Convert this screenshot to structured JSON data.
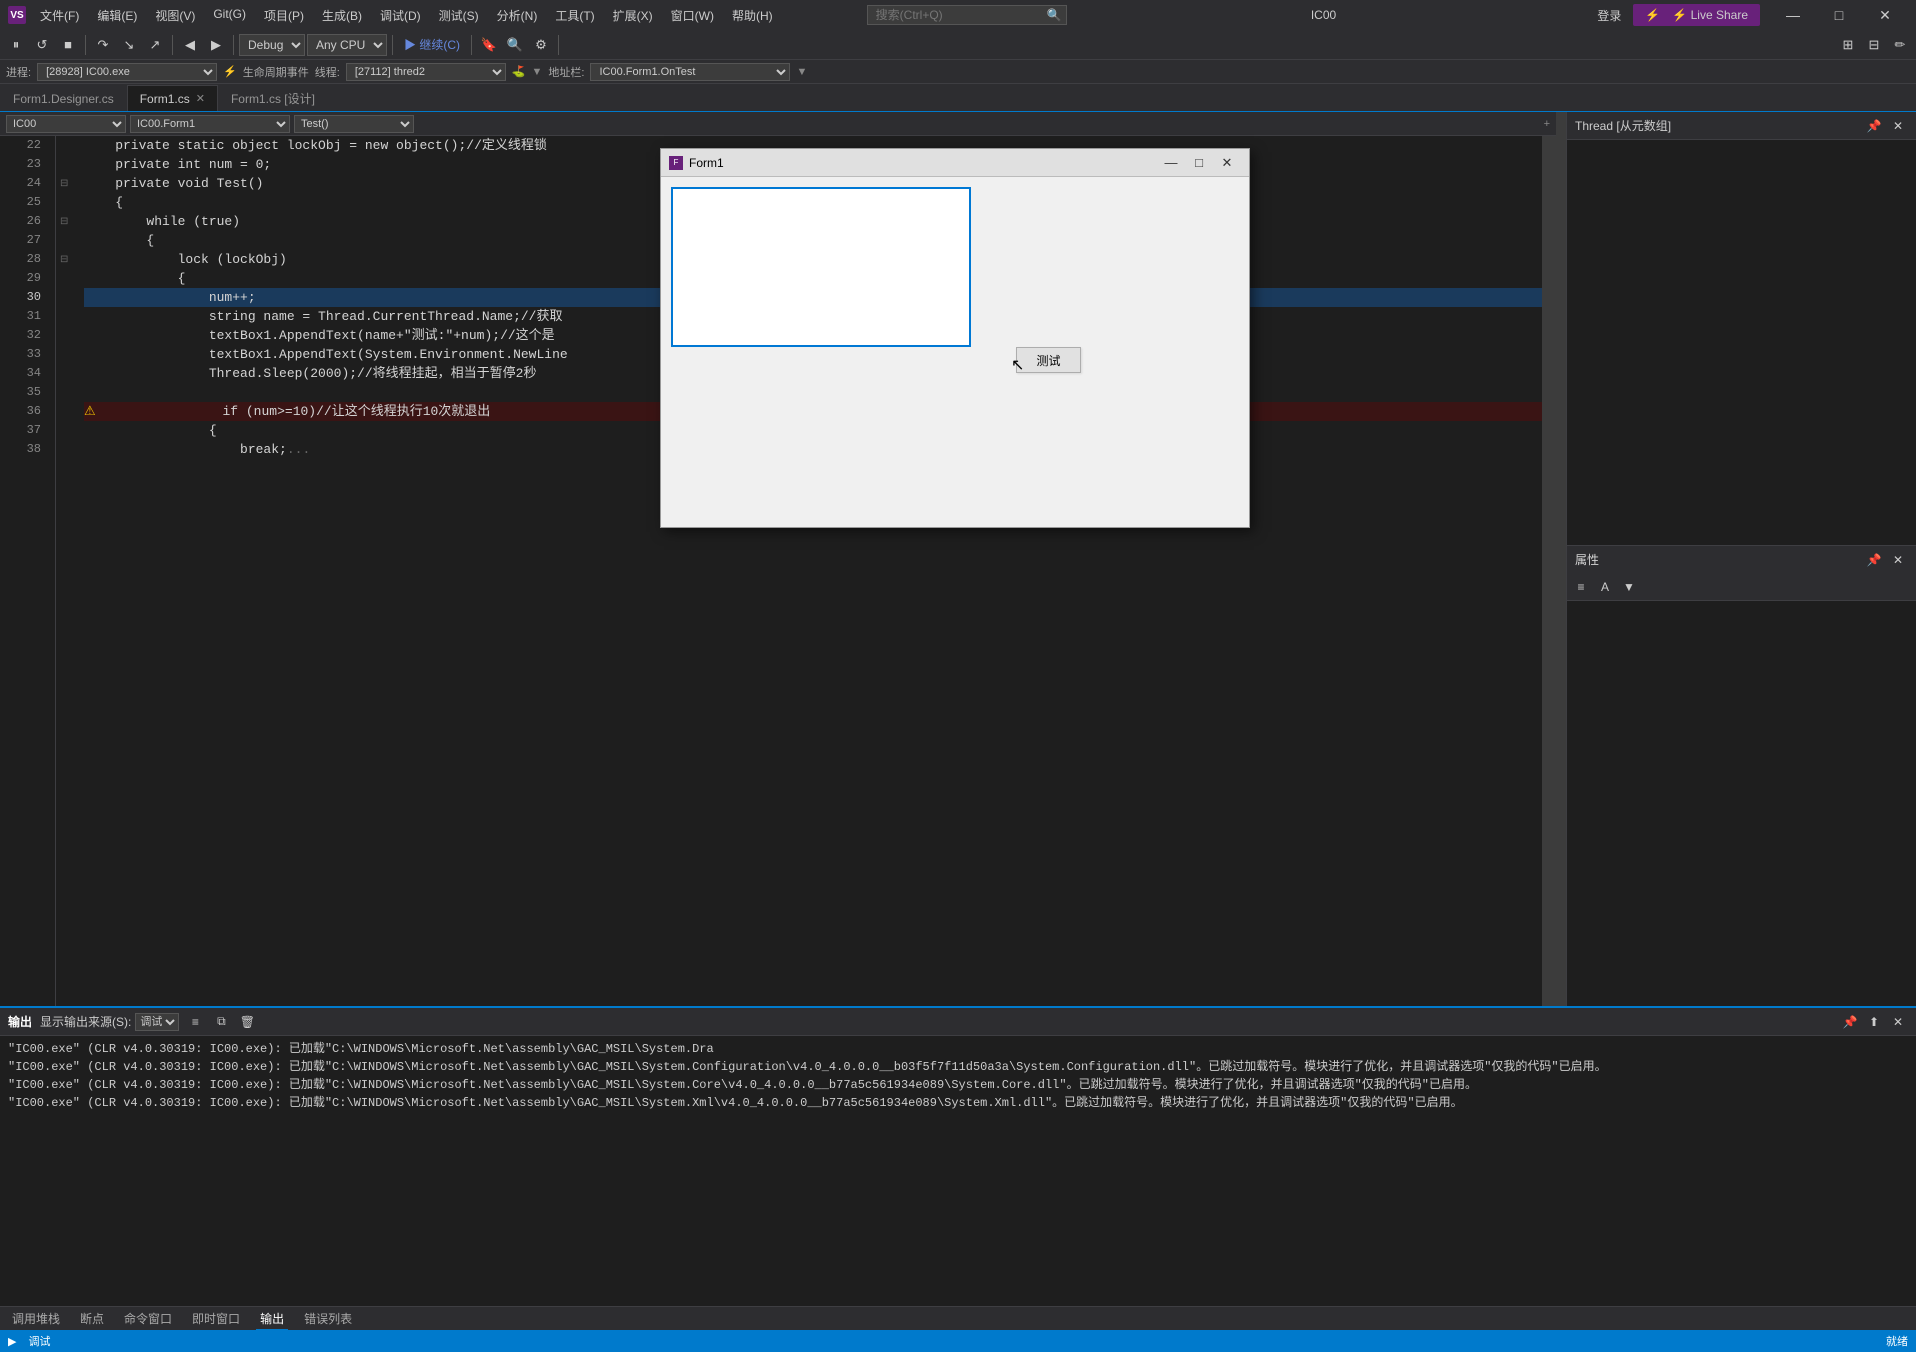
{
  "titlebar": {
    "logo": "VS",
    "menus": [
      "文件(F)",
      "编辑(E)",
      "视图(V)",
      "Git(G)",
      "项目(P)",
      "生成(B)",
      "调试(D)",
      "测试(S)",
      "分析(N)",
      "工具(T)",
      "扩展(X)",
      "窗口(W)",
      "帮助(H)"
    ],
    "search_placeholder": "搜索(Ctrl+Q)",
    "app_name": "IC00",
    "login": "登录",
    "min": "—",
    "max": "□",
    "close": "✕"
  },
  "toolbar": {
    "debug_config": "Debug",
    "platform": "Any CPU",
    "continue_btn": "继续(C)",
    "live_share": "⚡ Live Share"
  },
  "process_bar": {
    "label_process": "进程:",
    "process": "[28928] IC00.exe",
    "label_lifecycle": "生命周期事件",
    "label_thread": "线程:",
    "thread": "[27112] thred2",
    "label_location": "地址栏:",
    "location": "IC00.Form1.OnTest"
  },
  "tabs": [
    {
      "id": "designer",
      "label": "Form1.Designer.cs",
      "active": false,
      "closable": false
    },
    {
      "id": "form1cs",
      "label": "Form1.cs",
      "active": true,
      "closable": true
    },
    {
      "id": "design",
      "label": "Form1.cs [设计]",
      "active": false,
      "closable": false
    }
  ],
  "code_toolbar": {
    "namespace": "IC00",
    "class": "IC00.Form1",
    "method": "Test()"
  },
  "code_lines": [
    {
      "num": 22,
      "indent": 2,
      "text": "    private static object lockObj = new object();//定义线程锁",
      "type": "normal"
    },
    {
      "num": 23,
      "indent": 2,
      "text": "    private int num = 0;",
      "type": "normal"
    },
    {
      "num": 24,
      "indent": 2,
      "text": "    private void Test()",
      "type": "normal",
      "foldable": true
    },
    {
      "num": 25,
      "indent": 2,
      "text": "    {",
      "type": "normal"
    },
    {
      "num": 26,
      "indent": 3,
      "text": "        while (true)",
      "type": "normal",
      "foldable": true
    },
    {
      "num": 27,
      "indent": 3,
      "text": "        {",
      "type": "normal"
    },
    {
      "num": 28,
      "indent": 4,
      "text": "            lock (lockObj)",
      "type": "normal",
      "foldable": true
    },
    {
      "num": 29,
      "indent": 4,
      "text": "            {",
      "type": "normal"
    },
    {
      "num": 30,
      "indent": 5,
      "text": "                num++;",
      "type": "current"
    },
    {
      "num": 31,
      "indent": 5,
      "text": "                string name = Thread.CurrentThread.Name;//获取",
      "type": "normal"
    },
    {
      "num": 32,
      "indent": 5,
      "text": "                textBox1.AppendText(name+\"测试:\"+num);//这个是",
      "type": "normal"
    },
    {
      "num": 33,
      "indent": 5,
      "text": "                textBox1.AppendText(System.Environment.NewLine",
      "type": "normal"
    },
    {
      "num": 34,
      "indent": 5,
      "text": "                Thread.Sleep(2000);//将线程挂起，相当于暂停2秒",
      "type": "normal"
    },
    {
      "num": 35,
      "indent": 4,
      "text": "",
      "type": "normal"
    },
    {
      "num": 36,
      "indent": 4,
      "text": "                if (num>=10)//让这个线程执行10次就退出",
      "type": "breakpoint",
      "warning": true
    },
    {
      "num": 37,
      "indent": 4,
      "text": "                {",
      "type": "normal"
    },
    {
      "num": 38,
      "indent": 5,
      "text": "                    break;",
      "type": "normal",
      "truncated": true
    }
  ],
  "form1": {
    "title": "Form1",
    "button_label": "测试",
    "min": "—",
    "max": "□",
    "close": "✕"
  },
  "right_panel": {
    "title": "Thread [从元数组]",
    "label": "属性"
  },
  "output_panel": {
    "title": "输出",
    "source_label": "显示输出来源(S):",
    "source": "调试",
    "lines": [
      "\"IC00.exe\" (CLR v4.0.30319: IC00.exe): 已加载\"C:\\WINDOWS\\Microsoft.Net\\assembly\\GAC_MSIL\\System.Dra",
      "\"IC00.exe\" (CLR v4.0.30319: IC00.exe): 已加载\"C:\\WINDOWS\\Microsoft.Net\\assembly\\GAC_MSIL\\System.Configuration\\v4.0_4.0.0.0__b03f5f7f11d50a3a\\System.Configuration.dll\"。已跳过加载符号。模块进行了优化，并且调试器选项\"仅我的代码\"已启用。",
      "\"IC00.exe\" (CLR v4.0.30319: IC00.exe): 已加载\"C:\\WINDOWS\\Microsoft.Net\\assembly\\GAC_MSIL\\System.Core\\v4.0_4.0.0.0__b77a5c561934e089\\System.Core.dll\"。已跳过加载符号。模块进行了优化，并且调试器选项\"仅我的代码\"已启用。",
      "\"IC00.exe\" (CLR v4.0.30319: IC00.exe): 已加载\"C:\\WINDOWS\\Microsoft.Net\\assembly\\GAC_MSIL\\System.Xml\\v4.0_4.0.0.0__b77a5c561934e089\\System.Xml.dll\"。已跳过加载符号。模块进行了优化，并且调试器选项\"仅我的代码\"已启用。"
    ]
  },
  "bottom_tabs": [
    "调用堆栈",
    "断点",
    "命令窗口",
    "即时窗口",
    "输出",
    "错误列表"
  ],
  "status_bar": {
    "mode": "调试",
    "info": "就绪"
  },
  "icons": {
    "pause": "⏸",
    "restart": "↺",
    "step_over": "↷",
    "step_in": "↘",
    "step_out": "↗",
    "stop": "■",
    "search": "🔍",
    "settings": "⚙",
    "chevron_down": "▾",
    "close_x": "✕",
    "minimize": "—",
    "maximize": "□",
    "pin": "📌",
    "plus": "+",
    "menu": "≡",
    "arrow_up": "▲",
    "arrow_down": "▼",
    "copy": "⧉",
    "filter": "▼",
    "clear": "🗑"
  }
}
